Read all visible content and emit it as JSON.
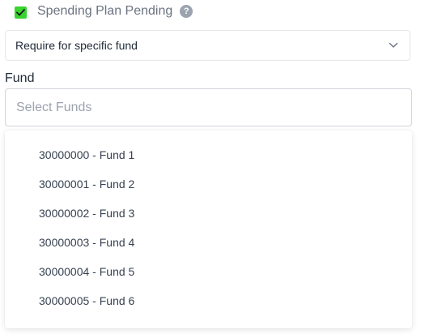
{
  "checkbox": {
    "label": "Spending Plan Pending",
    "checked": true,
    "help": "?"
  },
  "requirement_select": {
    "value": "Require for specific fund"
  },
  "fund_field": {
    "label": "Fund",
    "placeholder": "Select Funds"
  },
  "fund_options": [
    "30000000 - Fund 1",
    "30000001 - Fund 2",
    "30000002 - Fund 3",
    "30000003 - Fund 4",
    "30000004 - Fund 5",
    "30000005 - Fund 6"
  ],
  "colors": {
    "checkbox_fill": "#38d430",
    "help_icon": "#9ca3af"
  },
  "icons": {
    "checkbox": "check-icon",
    "help": "question-circle-icon",
    "select": "chevron-down-icon"
  }
}
